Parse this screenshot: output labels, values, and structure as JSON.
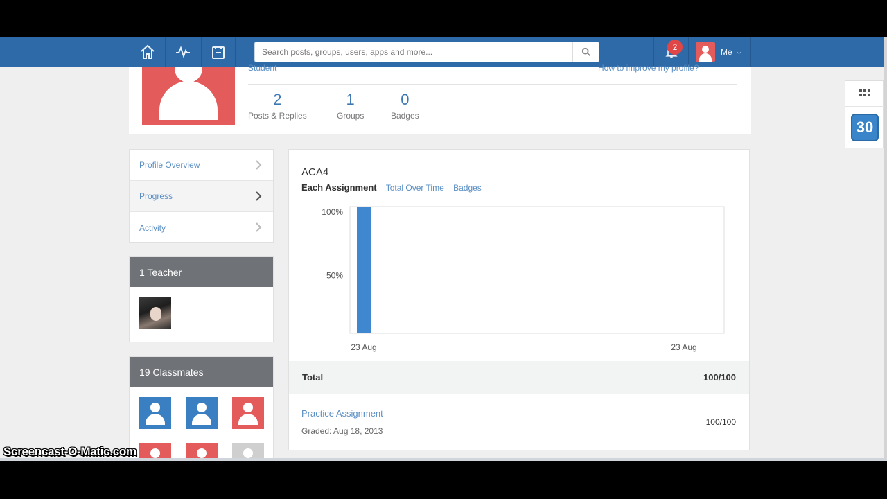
{
  "nav": {
    "search_placeholder": "Search posts, groups, users, apps and more...",
    "notification_count": "2",
    "me_label": "Me"
  },
  "profile": {
    "role_partial": "Student",
    "improve_link": "How to improve my profile?",
    "stats": [
      {
        "value": "2",
        "label": "Posts & Replies"
      },
      {
        "value": "1",
        "label": "Groups"
      },
      {
        "value": "0",
        "label": "Badges"
      }
    ]
  },
  "menu": {
    "items": [
      {
        "label": "Profile Overview"
      },
      {
        "label": "Progress"
      },
      {
        "label": "Activity"
      }
    ]
  },
  "teachers": {
    "header": "1 Teacher"
  },
  "classmates": {
    "header": "19 Classmates"
  },
  "progress": {
    "course": "ACA4",
    "tabs": [
      "Each Assignment",
      "Total Over Time",
      "Badges"
    ],
    "total_label": "Total",
    "total_value": "100/100",
    "assignment": {
      "name": "Practice Assignment",
      "graded": "Graded: Aug 18, 2013",
      "score": "100/100"
    }
  },
  "chart_data": {
    "type": "bar",
    "categories": [
      "23 Aug"
    ],
    "values": [
      100
    ],
    "x_tick_labels": [
      "23 Aug",
      "23 Aug"
    ],
    "y_tick_labels": [
      "100%",
      "50%"
    ],
    "ylim": [
      0,
      100
    ],
    "color": "#3f87cf",
    "title": "",
    "xlabel": "",
    "ylabel": ""
  },
  "watermark": "Screencast-O-Matic.com",
  "colors": {
    "nav": "#2e6aa8",
    "accent": "#5b8fc4",
    "avatar_red": "#e35b5b",
    "avatar_blue": "#3a7fc1",
    "avatar_gray": "#cfcfcf",
    "panel_header": "#6f7378"
  }
}
